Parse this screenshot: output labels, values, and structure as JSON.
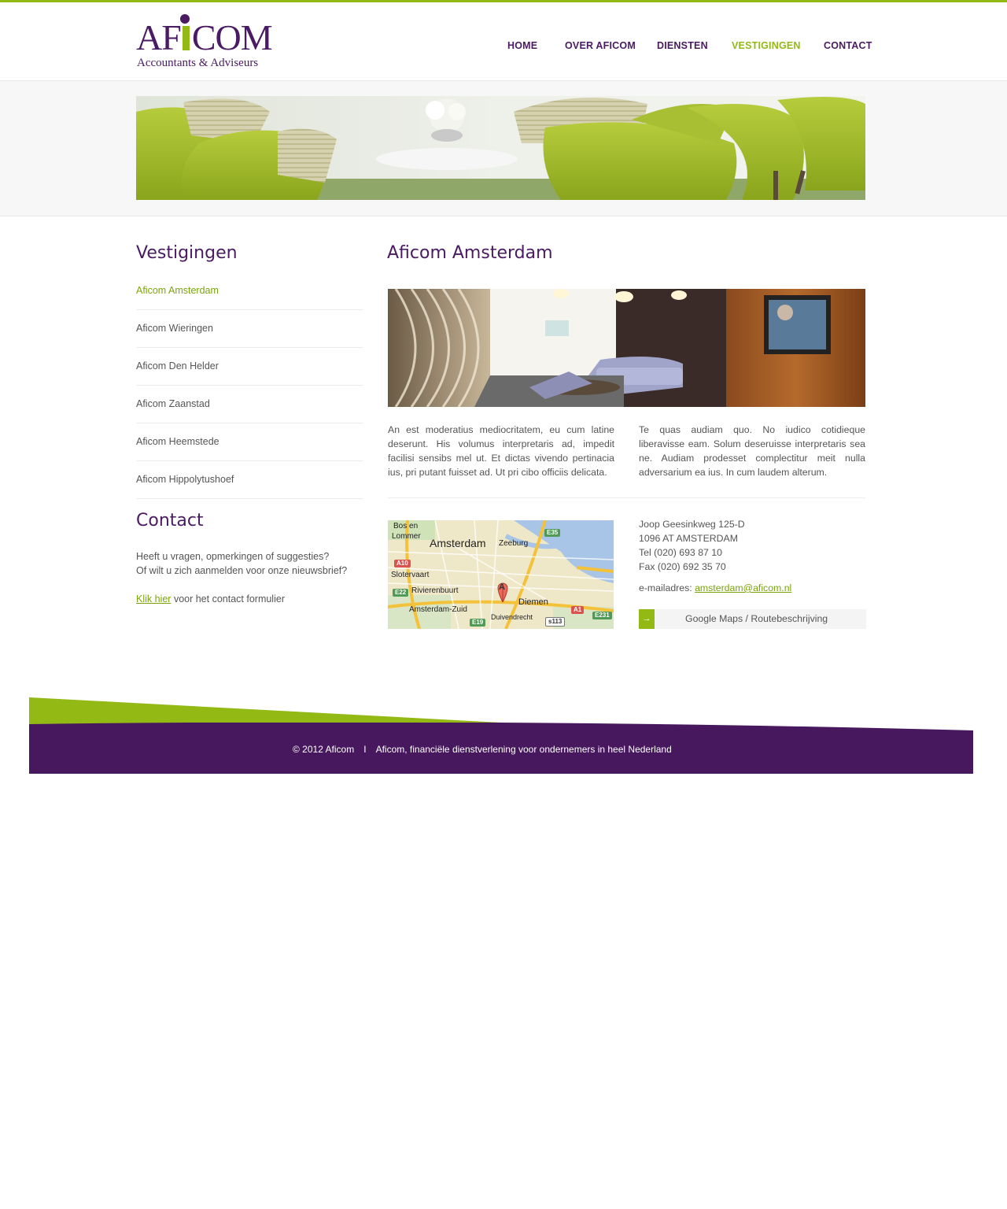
{
  "brand": {
    "logo_main": "AFICOM",
    "logo_sub": "Accountants & Adviseurs",
    "color_purple": "#4a1a62",
    "color_green": "#93b914"
  },
  "nav": {
    "items": [
      {
        "label": "HOME"
      },
      {
        "label": "OVER AFICOM"
      },
      {
        "label": "DIENSTEN"
      },
      {
        "label": "VESTIGINGEN",
        "active": true
      },
      {
        "label": "CONTACT"
      }
    ]
  },
  "sidebar": {
    "title": "Vestigingen",
    "items": [
      {
        "label": "Aficom Amsterdam",
        "active": true
      },
      {
        "label": "Aficom Wieringen"
      },
      {
        "label": "Aficom Den Helder"
      },
      {
        "label": "Aficom Zaanstad"
      },
      {
        "label": "Aficom Heemstede"
      },
      {
        "label": "Aficom Hippolytushoef"
      }
    ],
    "contact": {
      "title": "Contact",
      "line1": "Heeft u vragen, opmerkingen of suggesties?",
      "line2": "Of wilt u zich aanmelden voor onze nieuwsbrief?",
      "link_label": "Klik hier",
      "link_suffix": " voor het contact formulier"
    }
  },
  "main": {
    "title": "Aficom Amsterdam",
    "col_left": "An est moderatius mediocritatem, eu cum latine deserunt. His volumus interpretaris ad, impedit facilisi sensibs mel ut. Et dictas vivendo pertinacia ius, pri putant fuisset ad. Ut pri cibo officiis delicata.",
    "col_right": "Te quas audiam quo. No iudico cotidieque liberavisse eam. Solum deseruisse interpretaris sea ne. Audiam prodesset complectitur meit nulla adversarium ea ius. In cum laudem alterum."
  },
  "map": {
    "labels": {
      "bos1": "Bos en",
      "bos2": "Lommer",
      "amsterdam": "Amsterdam",
      "zeeburg": "Zeeburg",
      "slotervaart": "Slotervaart",
      "rivierenbuurt": "Rivierenbuurt",
      "diemen": "Diemen",
      "zuid": "Amsterdam-Zuid",
      "duivendrecht": "Duivendrecht",
      "marker": "A"
    },
    "roads": {
      "e35": "E35",
      "a10": "A10",
      "e22": "E22",
      "a1": "A1",
      "e231": "E231",
      "e19": "E19",
      "s113": "s113"
    }
  },
  "address": {
    "street": "Joop Geesinkweg 125-D",
    "city": "1096 AT AMSTERDAM",
    "tel": "Tel (020) 693 87 10",
    "fax": "Fax (020) 692 35 70",
    "email_label": "e-mailadres: ",
    "email": "amsterdam@aficom.nl",
    "maps_button": "Google Maps / Routebeschrijving",
    "maps_arrow": "→"
  },
  "footer": {
    "copyright": "© 2012 Aficom",
    "separator": "I",
    "tagline": "Aficom, financiële dienstverlening voor ondernemers in heel Nederland"
  }
}
